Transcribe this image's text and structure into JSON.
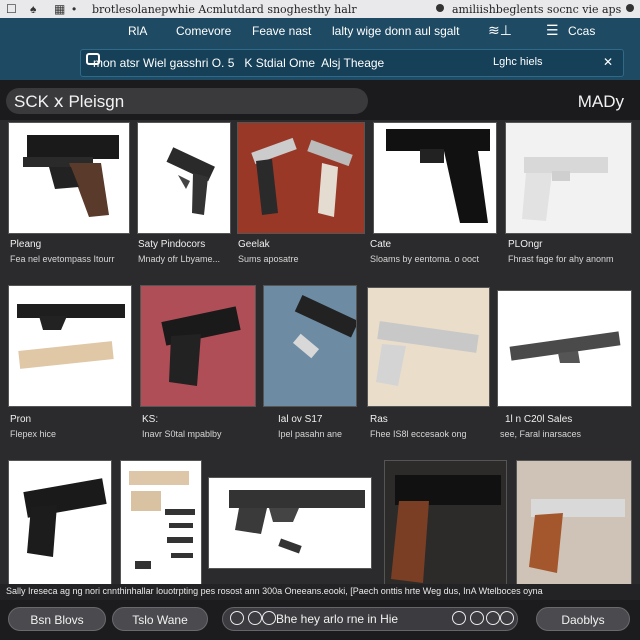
{
  "topbar": {
    "left_text": "brotlesolanepwhie Acmlutdard snoghesthy halr",
    "right_text": "amiliishbeglents socnc vie aps"
  },
  "nav": {
    "items": [
      "RlA",
      "Comevore",
      "Feave nast",
      "lalty wige donn aul sgalt",
      "Ccas"
    ]
  },
  "search": {
    "value": "mon atsr Wiel gasshri O. 5   K Stdial Ome  Alsj Theage",
    "hints": "Lghc hiels"
  },
  "section": {
    "title": "SCK ⅹ Pleisgn",
    "right": "MADy"
  },
  "grid": {
    "row1": [
      {
        "title": "Pleang",
        "sub": "Fea nel evetompass Itourr"
      },
      {
        "title": "Saty Pindocors",
        "sub": "Mnady ofr Lbyame..."
      },
      {
        "title": "Geelak",
        "sub": "Sums aposatre"
      },
      {
        "title": "Cate",
        "sub": "Sloams by eentoma. o ooct"
      },
      {
        "title": "PLOngr",
        "sub": "Fhrast fage for ahy anonm"
      }
    ],
    "row2": [
      {
        "title": "Pron",
        "sub": "Flepex hice"
      },
      {
        "title": "KS:",
        "sub": "Inavr S0tal mpablby"
      },
      {
        "title": "Ial ov S17",
        "sub": "Ipel pasahn ane"
      },
      {
        "title": "Ras",
        "sub": "Fhee IS8l eccesaok ong"
      },
      {
        "title": "1l n C20l Sales",
        "sub": "see, Faral inarsaces"
      }
    ]
  },
  "caption_strip": "Sally Ireseca ag ng nori cnnthinhallar louotrpting pes rosost ann 300a Oneeans.eooki, [Paech onttis hrte Weg dus, InA Wtelboces oyna",
  "footer": {
    "left_button": "Bsn Blovs",
    "mid_button": "Tslo Wane",
    "search_text": "Bhe hey arlo rne in Hie",
    "right_button": "Daoblys"
  },
  "colors": {
    "header": "#1e4a63",
    "background": "#2b2b2d"
  }
}
